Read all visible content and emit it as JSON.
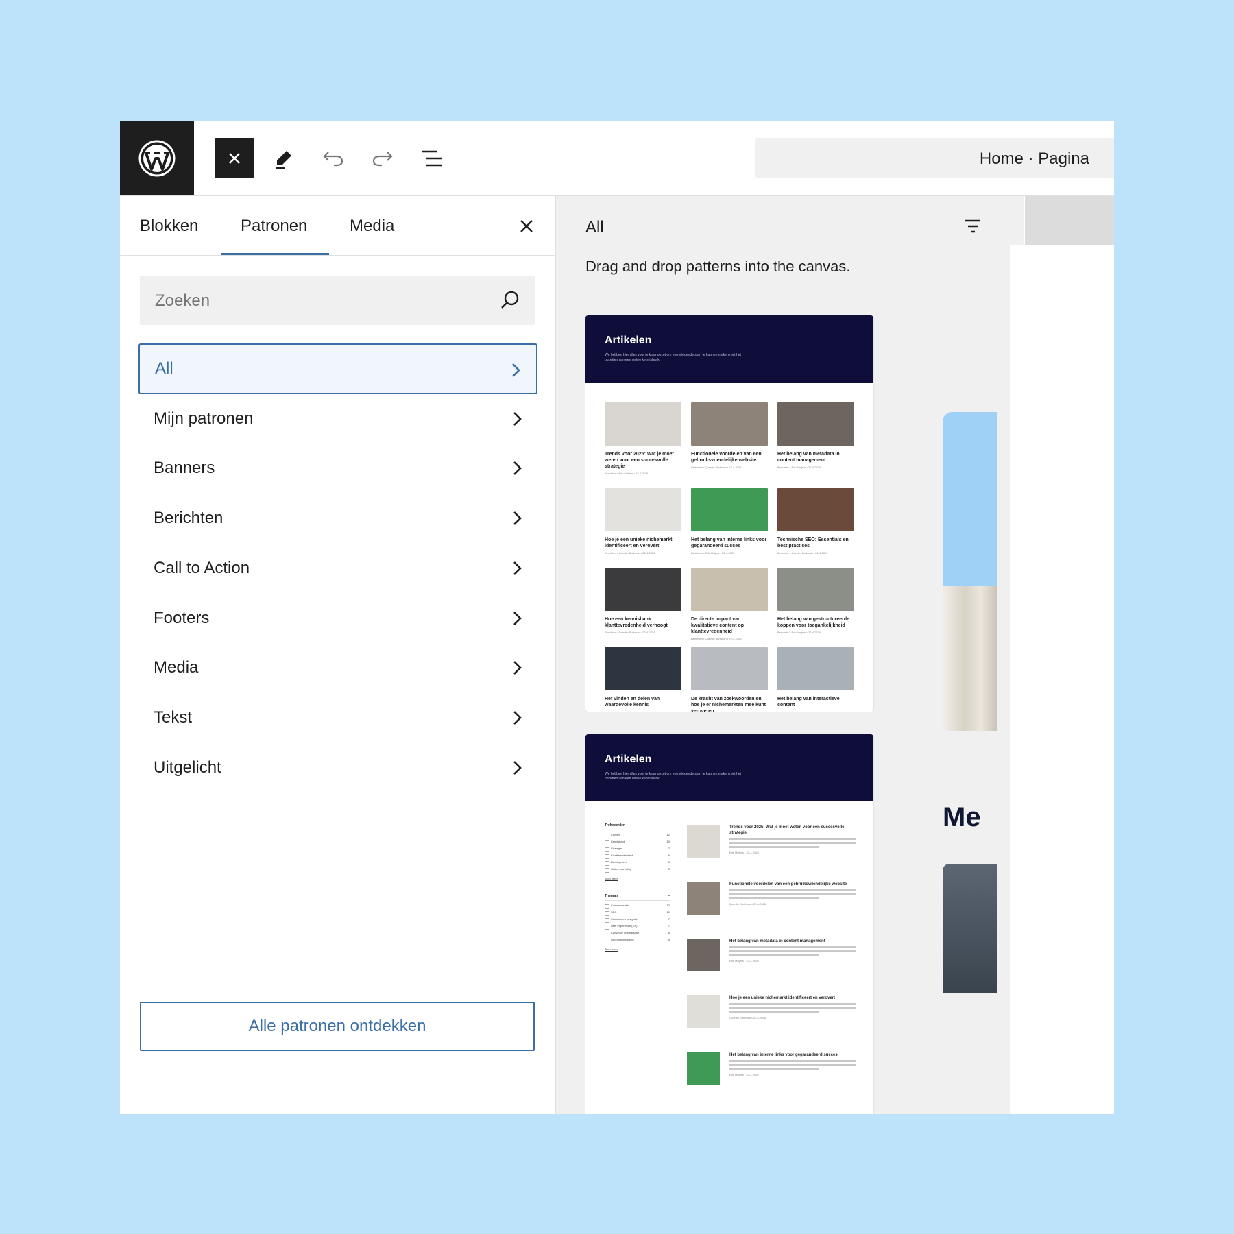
{
  "breadcrumb": "Home · Pagina",
  "tabs": [
    "Blokken",
    "Patronen",
    "Media"
  ],
  "search": {
    "placeholder": "Zoeken"
  },
  "categories": [
    {
      "label": "All",
      "active": true
    },
    {
      "label": "Mijn patronen"
    },
    {
      "label": "Banners"
    },
    {
      "label": "Berichten"
    },
    {
      "label": "Call to Action"
    },
    {
      "label": "Footers"
    },
    {
      "label": "Media"
    },
    {
      "label": "Tekst"
    },
    {
      "label": "Uitgelicht"
    }
  ],
  "explore_button": "Alle patronen ontdekken",
  "preview": {
    "title": "All",
    "description": "Drag and drop patterns into the canvas.",
    "patterns": [
      {
        "title": "Artikelen",
        "subtitle": "We hebben hier alles voor je klaar gezet om een vliegende start te kunnen maken met het opzetten van een online kennisbank.",
        "items": [
          {
            "title": "Trends voor 2025: Wat je moet weten voor een succesvolle strategie",
            "meta": "Berichten • Erik Meijers • 22-4-2026",
            "color": "#d9d6d2"
          },
          {
            "title": "Functionele voordelen van een gebruiksvriendelijke website",
            "meta": "Berichten • Quentin Burkman • 22-4-2026",
            "color": "#8d8378"
          },
          {
            "title": "Het belang van metadata in content management",
            "meta": "Berichten • Erik Meijers • 22-4-2026",
            "color": "#6d6660"
          },
          {
            "title": "Hoe je een unieke nichemarkt identificeert en verovert",
            "meta": "Berichten • Quentin Burkman • 22-4-2026",
            "color": "#e4e2de"
          },
          {
            "title": "Het belang van interne links voor gegarandeerd succes",
            "meta": "Berichten • Erik Meijers • 22-4-2026",
            "color": "#3f9a55"
          },
          {
            "title": "Technische SEO: Essentials en best practices",
            "meta": "Berichten • Quentin Burkman • 22-4-2026",
            "color": "#6a4a3a"
          },
          {
            "title": "Hoe een kennisbank klanttevredenheid verhoogt",
            "meta": "Berichten • Quentin Burkman • 22-4-2026",
            "color": "#3b3a3c"
          },
          {
            "title": "De directe impact van kwalitatieve content op klanttevredenheid",
            "meta": "Berichten • Quentin Burkman • 22-4-2026",
            "color": "#c8bfae"
          },
          {
            "title": "Het belang van gestructureerde koppen voor toegankelijkheid",
            "meta": "Berichten • Erik Meijers • 22-4-2026",
            "color": "#8c8f88"
          },
          {
            "title": "Het vinden en delen van waardevolle kennis",
            "meta": "",
            "color": "#2f3540"
          },
          {
            "title": "De kracht van zoekwoorden en hoe je er nichemarkten mee kunt veroveren",
            "meta": "",
            "color": "#b8bcc0"
          },
          {
            "title": "Het belang van interactieve content",
            "meta": "",
            "color": "#a9b0b6"
          }
        ]
      },
      {
        "title": "Artikelen",
        "subtitle": "We hebben hier alles voor je klaar gezet om een vliegende start te kunnen maken met het opzetten van een online kennisbank.",
        "filters": [
          {
            "heading": "Trefwoorden",
            "rows": [
              [
                "Content",
                "12"
              ],
              [
                "Kennisbank",
                "10"
              ],
              [
                "Strategie",
                "7"
              ],
              [
                "Klanttevredenheid",
                "6"
              ],
              [
                "Development",
                "5"
              ],
              [
                "Online marketing",
                "5"
              ]
            ],
            "more": "Toon meer"
          },
          {
            "heading": "Thema's",
            "rows": [
              [
                "Contentcreatie",
                "12"
              ],
              [
                "SEO",
                "10"
              ],
              [
                "Structuur en navigatie",
                "7"
              ],
              [
                "User experience (UX)",
                "7"
              ],
              [
                "Conversie optimalisatie",
                "6"
              ],
              [
                "Gebruiksvriendelijk",
                "5"
              ]
            ],
            "more": "Toon meer"
          }
        ],
        "list": [
          {
            "title": "Trends voor 2025: Wat je moet weten voor een succesvolle strategie",
            "meta": "Erik Meijers • 22-4-2026",
            "color": "#dcd8d2"
          },
          {
            "title": "Functionele voordelen van een gebruiksvriendelijke website",
            "meta": "Quentin Burkman • 22-4-2026",
            "color": "#8d8378"
          },
          {
            "title": "Het belang van metadata in content management",
            "meta": "Erik Meijers • 22-4-2026",
            "color": "#6d6660"
          },
          {
            "title": "Hoe je een unieke nichemarkt identificeert en verovert",
            "meta": "Quentin Burkman • 22-4-2026",
            "color": "#e0ded9"
          },
          {
            "title": "Het belang van interne links voor gegarandeerd succes",
            "meta": "Erik Meijers • 22-4-2026",
            "color": "#3f9a55"
          }
        ]
      }
    ]
  },
  "canvas": {
    "heading_fragment": "Me"
  },
  "colors": {
    "accent": "#3a6ea5",
    "dark": "#1e1e1e",
    "background": "#bde3fb",
    "pattern_header": "#0f0d3a"
  }
}
